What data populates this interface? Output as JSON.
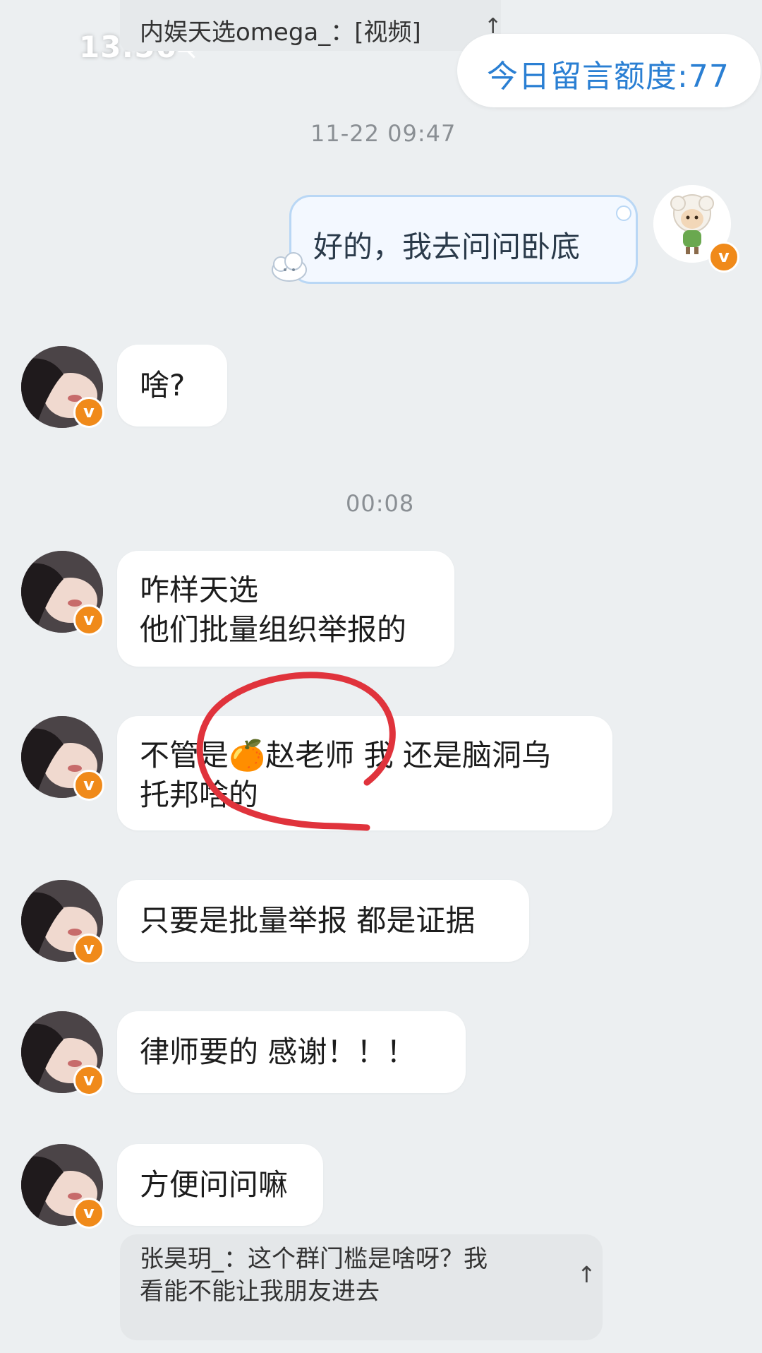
{
  "status_bar": {
    "time": "13:56",
    "icon": "mute-bell-icon"
  },
  "pinned_top": {
    "text": "内娱天选omega_：[视频]",
    "arrow": "↑"
  },
  "quota": {
    "label": "今日留言额度:77"
  },
  "timestamps": [
    "11-22 09:47",
    "00:08"
  ],
  "my_message": {
    "text": "好的，我去问问卧底"
  },
  "messages": [
    {
      "text": "啥?"
    },
    {
      "text": "咋样天选\n他们批量组织举报的"
    },
    {
      "text": "不管是🍊赵老师 我 还是脑洞乌\n托邦啥的"
    },
    {
      "text": "只要是批量举报 都是证据"
    },
    {
      "text": "律师要的 感谢！！！"
    },
    {
      "text": "方便问问嘛"
    }
  ],
  "pinned_bottom": {
    "text": "张昊玥_：这个群门槛是啥呀？我\n看能不能让我朋友进去",
    "arrow": "↑"
  },
  "badge_label": "v",
  "colors": {
    "accent_blue": "#2a7fd3",
    "annotation_red": "#e0333c",
    "verified_orange": "#f08a1a"
  }
}
